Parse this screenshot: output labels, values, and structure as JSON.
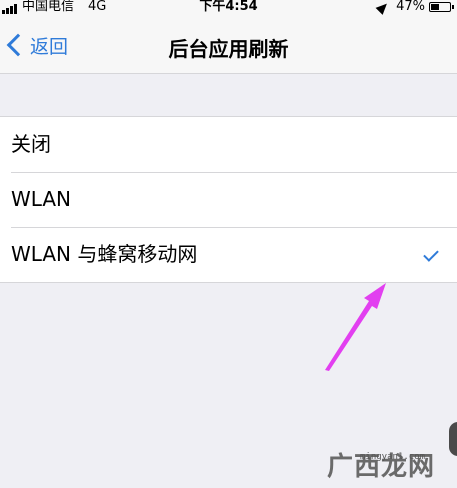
{
  "status_bar": {
    "carrier": "中国电信",
    "network": "4G",
    "time": "下午4:54",
    "battery_percent": "47%",
    "battery_level": 0.47,
    "location_icon": "location-arrow-icon",
    "signal_icon": "signal-bars-icon",
    "battery_icon": "battery-icon"
  },
  "nav": {
    "back_label": "返回",
    "title": "后台应用刷新"
  },
  "options": [
    {
      "label": "关闭",
      "selected": false
    },
    {
      "label": "WLAN",
      "selected": false
    },
    {
      "label": "WLAN 与蜂窝移动网",
      "selected": true
    }
  ],
  "annotation": {
    "arrow_color": "#e23ff0",
    "icon": "pointer-arrow-icon"
  },
  "watermark": {
    "url_text": "mingyan1.com",
    "logo_text": "广西龙网"
  },
  "colors": {
    "accent": "#2f7bd9",
    "background": "#efeff4",
    "cell": "#ffffff"
  }
}
